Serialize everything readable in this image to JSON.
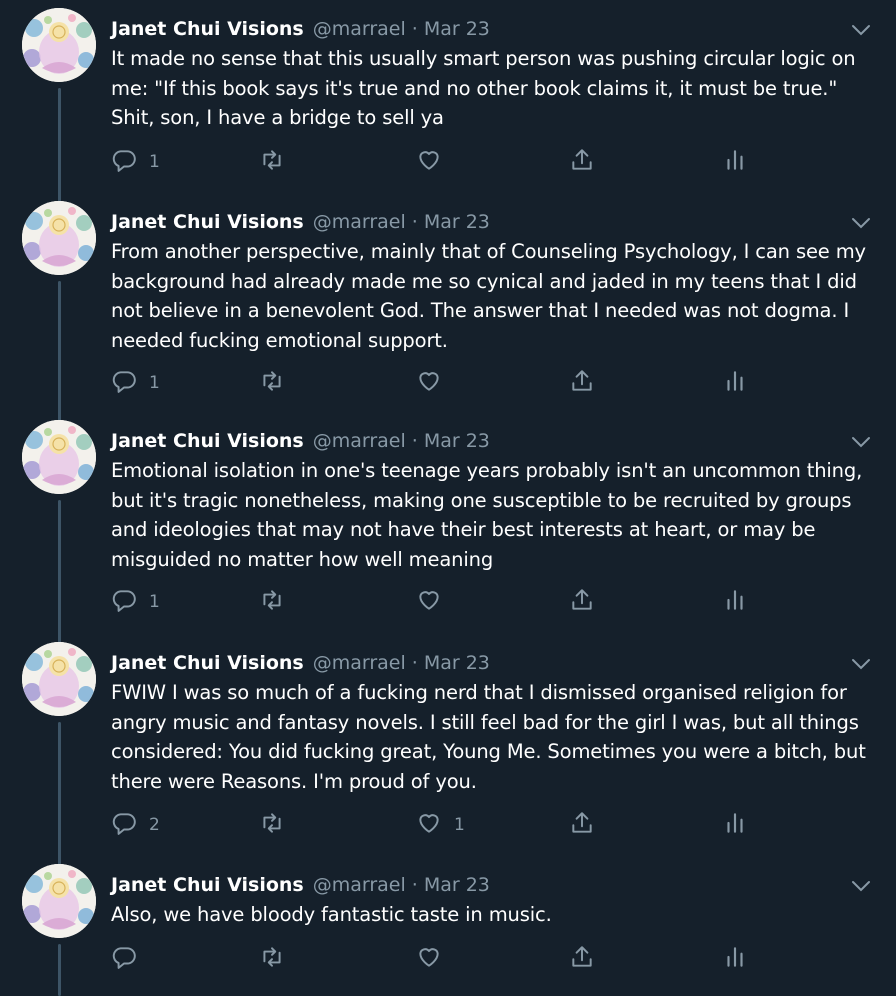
{
  "colors": {
    "background": "#15202b",
    "primary_text": "#ffffff",
    "secondary_text": "#8899a6",
    "thread_line": "#3d5466"
  },
  "icons": {
    "reply": "reply-icon",
    "retweet": "retweet-icon",
    "like": "like-icon",
    "share": "share-icon",
    "analytics": "analytics-icon",
    "more": "chevron-down-icon"
  },
  "tweets": [
    {
      "name": "Janet Chui Visions",
      "handle": "@marrael",
      "separator": "·",
      "date": "Mar 23",
      "text": "It made no sense that this usually smart person was pushing circular logic on me: \"If this book says it's true and no other book claims it, it must be true.\" Shit, son, I have a bridge to sell ya",
      "replies": "1",
      "retweets": "",
      "likes": ""
    },
    {
      "name": "Janet Chui Visions",
      "handle": "@marrael",
      "separator": "·",
      "date": "Mar 23",
      "text": "From another perspective, mainly that of Counseling Psychology, I can see my background had already made me so cynical and jaded in my teens that I did not believe in a benevolent God. The answer that I needed was not dogma. I needed fucking emotional support.",
      "replies": "1",
      "retweets": "",
      "likes": ""
    },
    {
      "name": "Janet Chui Visions",
      "handle": "@marrael",
      "separator": "·",
      "date": "Mar 23",
      "text": "Emotional isolation in one's teenage years probably isn't an uncommon thing, but it's tragic nonetheless, making one susceptible to be recruited by groups and ideologies that may not have their best interests at heart, or may be misguided no matter how well meaning",
      "replies": "1",
      "retweets": "",
      "likes": ""
    },
    {
      "name": "Janet Chui Visions",
      "handle": "@marrael",
      "separator": "·",
      "date": "Mar 23",
      "text": "FWIW I was so much of a fucking nerd that I dismissed organised religion for angry music and fantasy novels. I still feel bad for the girl I was, but all things considered: You did fucking great, Young Me. Sometimes you were a bitch, but there were Reasons. I'm proud of you.",
      "replies": "2",
      "retweets": "",
      "likes": "1"
    },
    {
      "name": "Janet Chui Visions",
      "handle": "@marrael",
      "separator": "·",
      "date": "Mar 23",
      "text": "Also, we have bloody fantastic taste in music.",
      "replies": "",
      "retweets": "",
      "likes": ""
    }
  ]
}
